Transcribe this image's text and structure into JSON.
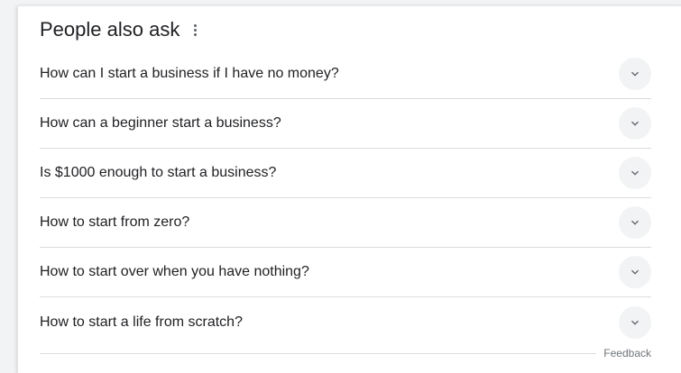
{
  "header": {
    "title": "People also ask",
    "menu_icon": "more-vertical-icon"
  },
  "questions": [
    {
      "text": "How can I start a business if I have no money?",
      "icon": "chevron-down-icon"
    },
    {
      "text": "How can a beginner start a business?",
      "icon": "chevron-down-icon"
    },
    {
      "text": "Is $1000 enough to start a business?",
      "icon": "chevron-down-icon"
    },
    {
      "text": "How to start from zero?",
      "icon": "chevron-down-icon"
    },
    {
      "text": "How to start over when you have nothing?",
      "icon": "chevron-down-icon"
    },
    {
      "text": "How to start a life from scratch?",
      "icon": "chevron-down-icon"
    }
  ],
  "footer": {
    "feedback_label": "Feedback"
  },
  "colors": {
    "text": "#202124",
    "secondary_text": "#70757a",
    "divider": "#dadce0",
    "chevron_bg": "#f1f3f4",
    "icon": "#5f6368"
  }
}
